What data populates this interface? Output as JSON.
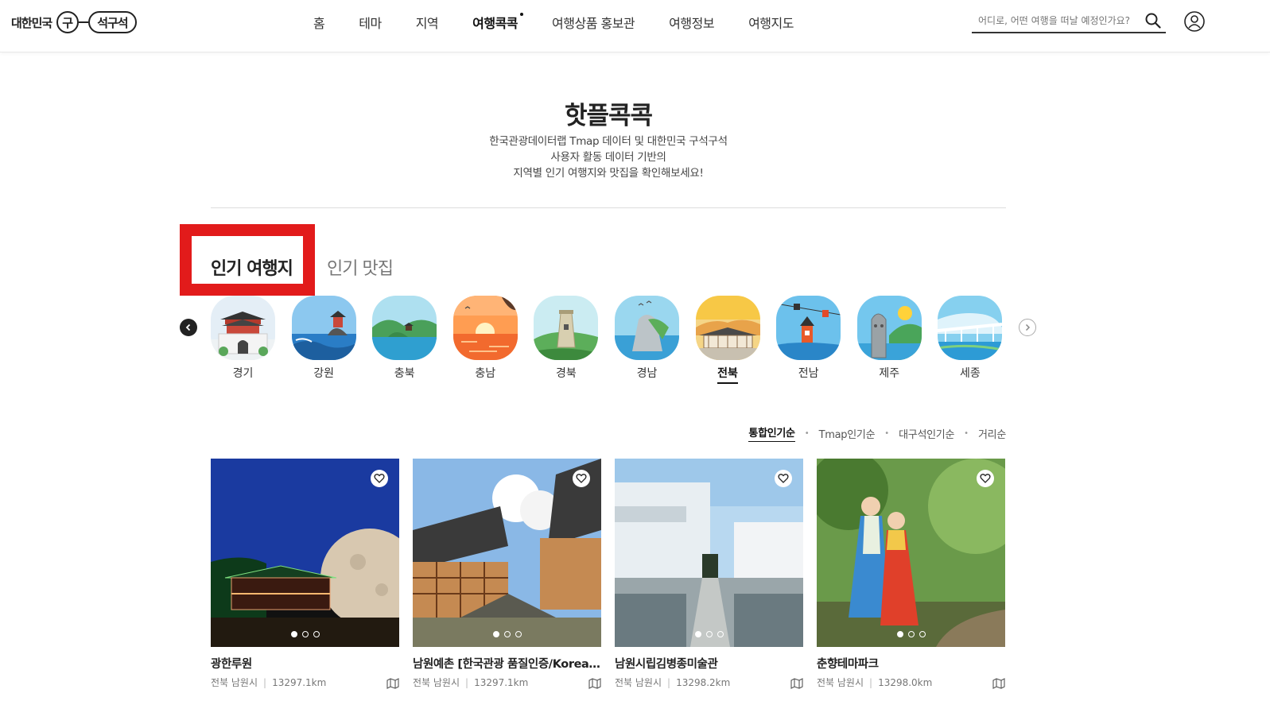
{
  "header": {
    "logo": {
      "prefix": "대한민국",
      "circle": "구",
      "pill": "석구석"
    },
    "nav": [
      "홈",
      "테마",
      "지역",
      "여행콕콕",
      "여행상품 홍보관",
      "여행정보",
      "여행지도"
    ],
    "search_placeholder": "어디로, 어떤 여행을 떠날 예정인가요?"
  },
  "hero": {
    "title": "핫플콕콕",
    "desc_lines": [
      "한국관광데이터랩 Tmap 데이터 및 대한민국 구석구석",
      "사용자 활동 데이터 기반의",
      "지역별 인기 여행지와 맛집을 확인해보세요!"
    ]
  },
  "tabs": [
    "인기 여행지",
    "인기 맛집"
  ],
  "regions": [
    {
      "label": "경기",
      "icon": "palace-gate-icon",
      "colors": [
        "#dde9f3",
        "#ffffff"
      ]
    },
    {
      "label": "강원",
      "icon": "coast-pavilion-icon",
      "colors": [
        "#6fb5e8",
        "#2a7dc6"
      ]
    },
    {
      "label": "충북",
      "icon": "lake-island-icon",
      "colors": [
        "#9cd8ec",
        "#2f9fd0"
      ]
    },
    {
      "label": "충남",
      "icon": "sunset-sea-icon",
      "colors": [
        "#ff8c42",
        "#f26a2e"
      ]
    },
    {
      "label": "경북",
      "icon": "observatory-icon",
      "colors": [
        "#bfe6ef",
        "#5cae5a"
      ]
    },
    {
      "label": "경남",
      "icon": "sea-cliff-icon",
      "colors": [
        "#8fd2ee",
        "#3aa0d6"
      ]
    },
    {
      "label": "전북",
      "icon": "hanok-village-icon",
      "colors": [
        "#f7c846",
        "#f09a2c"
      ]
    },
    {
      "label": "전남",
      "icon": "cable-car-icon",
      "colors": [
        "#5bb6e6",
        "#2a86c8"
      ]
    },
    {
      "label": "제주",
      "icon": "stone-statue-icon",
      "colors": [
        "#66c0ea",
        "#3aa3d9"
      ]
    },
    {
      "label": "세종",
      "icon": "modern-bridge-icon",
      "colors": [
        "#71c8ee",
        "#2d9bd5"
      ]
    }
  ],
  "active_region": "전북",
  "sort": [
    "통합인기순",
    "Tmap인기순",
    "대구석인기순",
    "거리순"
  ],
  "cards": [
    {
      "title": "광한루원",
      "region": "전북 남원시",
      "distance": "13297.1km",
      "icon": "night-pavilion-moon"
    },
    {
      "title": "남원예촌 [한국관광 품질인증/Korea Quality]",
      "region": "전북 남원시",
      "distance": "13297.1km",
      "icon": "hanok-roof"
    },
    {
      "title": "남원시립김병종미술관",
      "region": "전북 남원시",
      "distance": "13298.2km",
      "icon": "white-museum"
    },
    {
      "title": "춘향테마파크",
      "region": "전북 남원시",
      "distance": "13298.0km",
      "icon": "couple-statues"
    }
  ]
}
